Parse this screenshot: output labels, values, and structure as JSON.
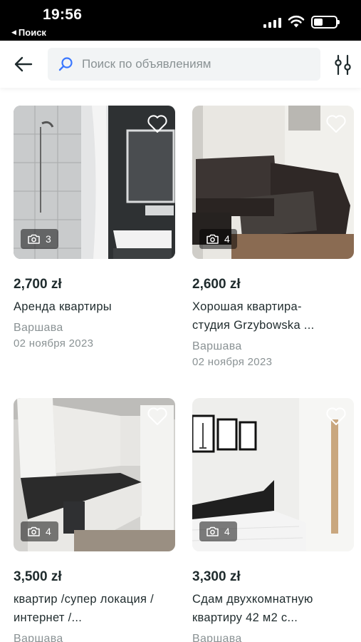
{
  "status_bar": {
    "time": "19:56",
    "back_label": "Поиск"
  },
  "header": {
    "search_placeholder": "Поиск по объявлениям"
  },
  "colors": {
    "accent": "#3a77ff",
    "text": "#1f2b2d",
    "muted": "#8a9294"
  },
  "listings": [
    {
      "price": "2,700 zł",
      "title_lines": [
        "Аренда квартиры"
      ],
      "city": "Варшава",
      "date": "02 ноября 2023",
      "photo_count": "3"
    },
    {
      "price": "2,600 zł",
      "title_lines": [
        "Хорошая квартира-",
        "студия Grzybowska ..."
      ],
      "city": "Варшава",
      "date": "02 ноября 2023",
      "photo_count": "4"
    },
    {
      "price": "3,500 zł",
      "title_lines": [
        "квартир /супер локация /",
        "интернет /..."
      ],
      "city": "Варшава",
      "date": "",
      "photo_count": "4"
    },
    {
      "price": "3,300 zł",
      "title_lines": [
        "Сдам двухкомнатную",
        "квартиру 42 м2 с..."
      ],
      "city": "Варшава",
      "date": "",
      "photo_count": "4"
    }
  ]
}
